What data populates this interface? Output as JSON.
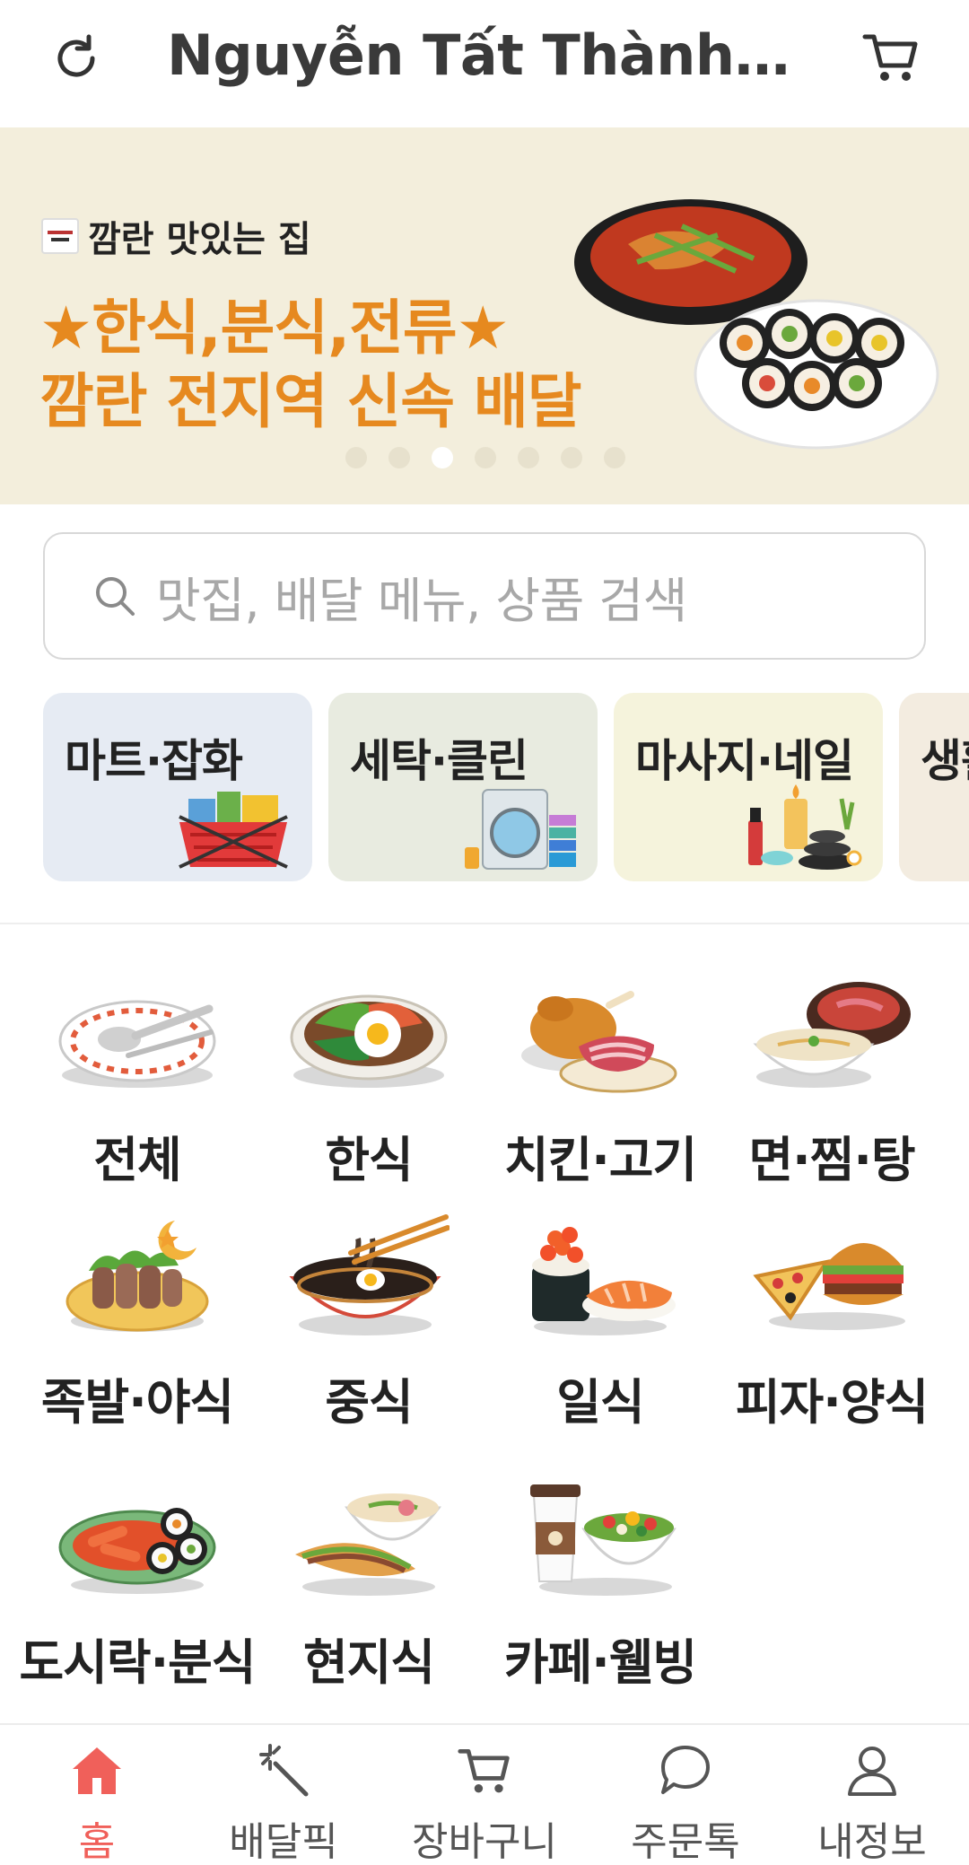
{
  "header": {
    "title": "Nguyễn Tất Thành C...",
    "refresh_icon": "refresh-icon",
    "cart_icon": "cart-icon"
  },
  "banner": {
    "brand_name": "깜란 맛있는 집",
    "line1": "★한식,분식,전류★",
    "line2": "깜란 전지역 신속 배달",
    "dot_count": 7,
    "active_dot": 3,
    "background_color": "#f3eedc",
    "accent_color": "#e6891f"
  },
  "search": {
    "placeholder": "맛집, 배달 메뉴, 상품 검색",
    "icon": "search-icon"
  },
  "services": [
    {
      "label": "마트·잡화",
      "bg": "#e6ebf3",
      "icon": "grocery-basket-icon"
    },
    {
      "label": "세탁·클린",
      "bg": "#e8ebe0",
      "icon": "washing-machine-icon"
    },
    {
      "label": "마사지·네일",
      "bg": "#f5f3dc",
      "icon": "spa-nail-icon"
    },
    {
      "label": "생활",
      "bg": "#f3ece0",
      "icon": "living-icon"
    }
  ],
  "food_categories": [
    {
      "label": "전체",
      "icon": "plate-spoon-icon"
    },
    {
      "label": "한식",
      "icon": "bibimbap-icon"
    },
    {
      "label": "치킨·고기",
      "icon": "chicken-meat-icon"
    },
    {
      "label": "면·찜·탕",
      "icon": "noodle-stew-icon"
    },
    {
      "label": "족발·야식",
      "icon": "jokbal-icon"
    },
    {
      "label": "중식",
      "icon": "jajangmyeon-icon"
    },
    {
      "label": "일식",
      "icon": "sushi-icon"
    },
    {
      "label": "피자·양식",
      "icon": "pizza-burger-icon"
    },
    {
      "label": "도시락·분식",
      "icon": "tteokbokki-icon"
    },
    {
      "label": "현지식",
      "icon": "banh-mi-pho-icon"
    },
    {
      "label": "카페·웰빙",
      "icon": "coffee-salad-icon"
    }
  ],
  "bottom_nav": [
    {
      "label": "홈",
      "icon": "home-icon",
      "active": true
    },
    {
      "label": "배달픽",
      "icon": "magic-wand-icon",
      "active": false
    },
    {
      "label": "장바구니",
      "icon": "cart-icon",
      "active": false
    },
    {
      "label": "주문톡",
      "icon": "chat-bubble-icon",
      "active": false
    },
    {
      "label": "내정보",
      "icon": "user-icon",
      "active": false
    }
  ],
  "colors": {
    "active_nav": "#f0605a",
    "inactive_nav": "#555555"
  }
}
